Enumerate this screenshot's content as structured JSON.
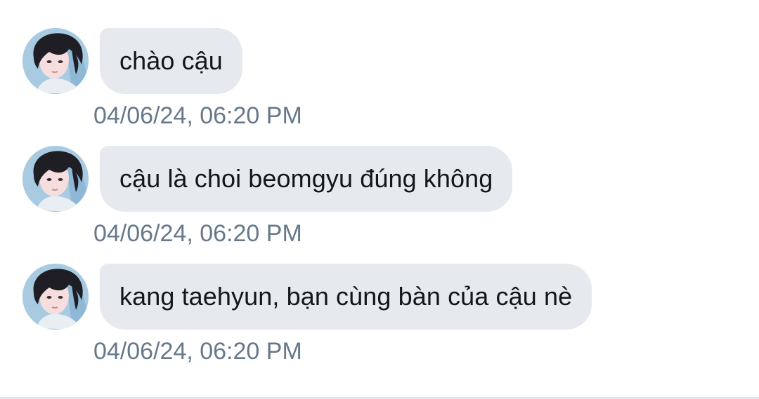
{
  "colors": {
    "bubble_background": "#e6eaee",
    "message_text": "#14171a",
    "timestamp_text": "#66788a",
    "background": "#ffffff"
  },
  "messages": [
    {
      "text": "chào cậu",
      "timestamp": "04/06/24, 06:20 PM",
      "avatar": "user-avatar"
    },
    {
      "text": "cậu là choi beomgyu đúng không",
      "timestamp": "04/06/24, 06:20 PM",
      "avatar": "user-avatar"
    },
    {
      "text": "kang taehyun, bạn cùng bàn của cậu nè",
      "timestamp": "04/06/24, 06:20 PM",
      "avatar": "user-avatar"
    }
  ]
}
